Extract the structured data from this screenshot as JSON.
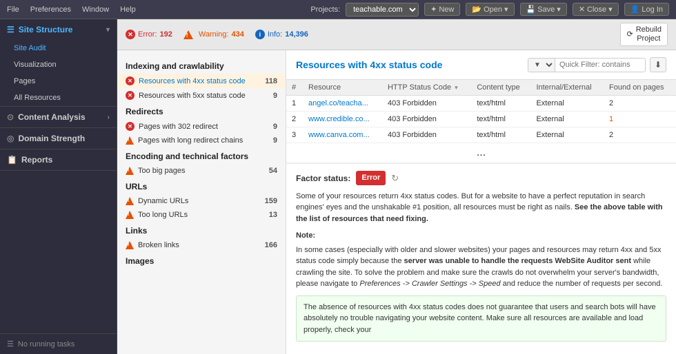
{
  "menubar": {
    "items": [
      "File",
      "Preferences",
      "Window",
      "Help"
    ],
    "projects_label": "Projects:",
    "projects_value": "teachable.com",
    "buttons": [
      {
        "label": "New",
        "icon": "✦"
      },
      {
        "label": "Open",
        "icon": "📂"
      },
      {
        "label": "Save",
        "icon": "💾"
      },
      {
        "label": "Close",
        "icon": "✕"
      },
      {
        "label": "Log In",
        "icon": "👤"
      }
    ]
  },
  "status_bar": {
    "error_label": "Error:",
    "error_count": "192",
    "warning_label": "Warning:",
    "warning_count": "434",
    "info_label": "Info:",
    "info_count": "14,396",
    "rebuild_label": "Rebuild\nProject"
  },
  "sidebar": {
    "site_structure_label": "Site Structure",
    "items": [
      {
        "label": "Site Audit",
        "active": true
      },
      {
        "label": "Visualization"
      },
      {
        "label": "Pages"
      },
      {
        "label": "All Resources"
      }
    ],
    "content_analysis_label": "Content Analysis",
    "domain_strength_label": "Domain Strength",
    "reports_label": "Reports",
    "footer_label": "No running tasks"
  },
  "issues_panel": {
    "sections": [
      {
        "title": "Indexing and crawlability",
        "items": [
          {
            "type": "error",
            "label": "Resources with 4xx status code",
            "count": "118",
            "active": true
          },
          {
            "type": "error",
            "label": "Resources with 5xx status code",
            "count": "9"
          }
        ]
      },
      {
        "title": "Redirects",
        "items": [
          {
            "type": "error",
            "label": "Pages with 302 redirect",
            "count": "9"
          },
          {
            "type": "warning",
            "label": "Pages with long redirect chains",
            "count": "9"
          }
        ]
      },
      {
        "title": "Encoding and technical factors",
        "items": [
          {
            "type": "warning",
            "label": "Too big pages",
            "count": "54"
          }
        ]
      },
      {
        "title": "URLs",
        "items": [
          {
            "type": "warning",
            "label": "Dynamic URLs",
            "count": "159"
          },
          {
            "type": "warning",
            "label": "Too long URLs",
            "count": "13"
          }
        ]
      },
      {
        "title": "Links",
        "items": [
          {
            "type": "warning",
            "label": "Broken links",
            "count": "166"
          }
        ]
      },
      {
        "title": "Images",
        "items": []
      }
    ]
  },
  "detail_panel": {
    "title": "Resources with 4xx status code",
    "filter_placeholder": "Quick Filter: contains",
    "filter_option": "▼",
    "columns": [
      "#",
      "Resource",
      "HTTP Status Code",
      "Content type",
      "Internal/External",
      "Found on pages"
    ],
    "rows": [
      {
        "num": "1",
        "resource": "angel.co/teacha...",
        "http_status": "403 Forbidden",
        "content_type": "text/html",
        "internal_external": "External",
        "found_on": "2"
      },
      {
        "num": "2",
        "resource": "www.credible.co...",
        "http_status": "403 Forbidden",
        "content_type": "text/html",
        "internal_external": "External",
        "found_on": "1"
      },
      {
        "num": "3",
        "resource": "www.canva.com...",
        "http_status": "403 Forbidden",
        "content_type": "text/html",
        "internal_external": "External",
        "found_on": "2"
      }
    ],
    "more_rows": "...",
    "factor_status": {
      "label": "Factor status:",
      "badge": "Error",
      "text1": "Some of your resources return 4xx status codes. But for a website to have a perfect reputation in search engines' eyes and the unshakable #1 position, all resources must be right as nails.",
      "text1_bold": "See the above table with the list of resources that need fixing.",
      "note_label": "Note:",
      "note_text": "In some cases (especially with older and slower websites) your pages and resources may return 4xx and 5xx status code simply because the",
      "note_bold": "server was unable to handle the requests WebSite Auditor sent",
      "note_text2": "while crawling the site. To solve the problem and make sure the crawls do not overwhelm your server's bandwidth, please navigate to",
      "note_italic": "Preferences -> Crawler Settings -> Speed",
      "note_text3": "and reduce the number of requests per second.",
      "green_text": "The absence of resources with 4xx status codes does not guarantee that users and search bots will have absolutely no trouble navigating your website content. Make sure all resources are available and load properly, check your"
    }
  }
}
